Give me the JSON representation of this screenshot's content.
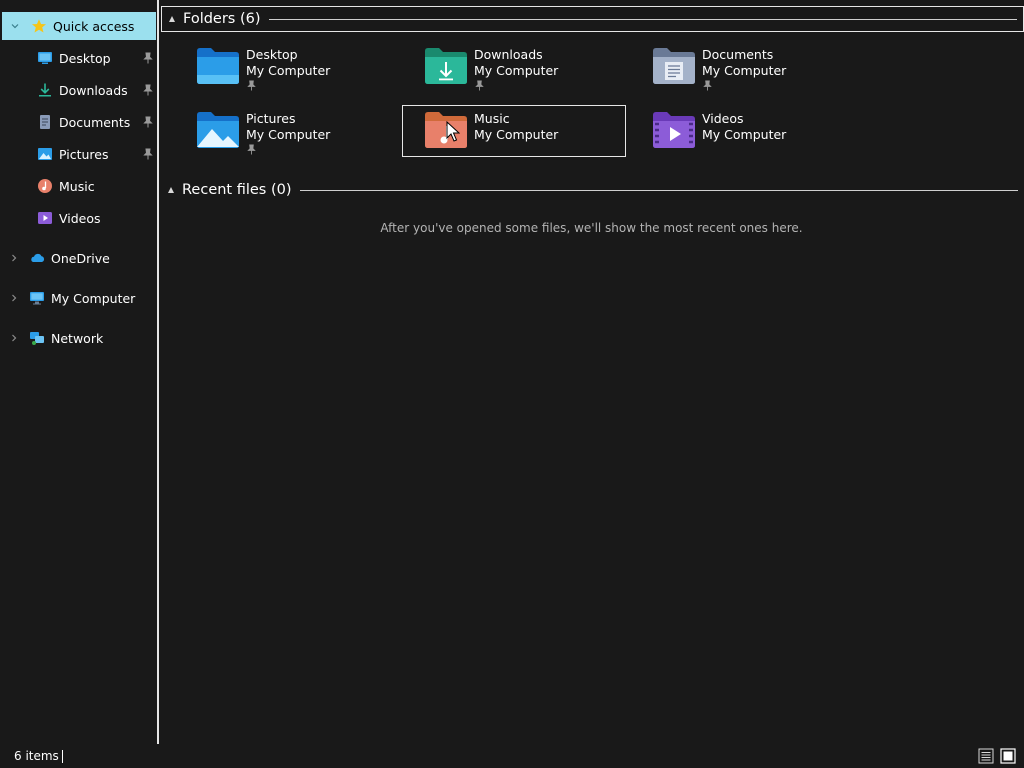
{
  "nav": {
    "quick_access": "Quick access",
    "pinned": [
      {
        "label": "Desktop",
        "icon": "desktop-icon",
        "pinned": true
      },
      {
        "label": "Downloads",
        "icon": "downloads-icon",
        "pinned": true
      },
      {
        "label": "Documents",
        "icon": "documents-icon",
        "pinned": true
      },
      {
        "label": "Pictures",
        "icon": "pictures-icon",
        "pinned": true
      },
      {
        "label": "Music",
        "icon": "music-icon",
        "pinned": false
      },
      {
        "label": "Videos",
        "icon": "videos-icon",
        "pinned": false
      }
    ],
    "roots": [
      {
        "label": "OneDrive",
        "icon": "onedrive-icon"
      },
      {
        "label": "My Computer",
        "icon": "computer-icon"
      },
      {
        "label": "Network",
        "icon": "network-icon"
      }
    ]
  },
  "folders_group": {
    "title": "Folders (6)",
    "items": [
      {
        "name": "Desktop",
        "location": "My Computer",
        "pinned": true
      },
      {
        "name": "Downloads",
        "location": "My Computer",
        "pinned": true
      },
      {
        "name": "Documents",
        "location": "My Computer",
        "pinned": true
      },
      {
        "name": "Pictures",
        "location": "My Computer",
        "pinned": true
      },
      {
        "name": "Music",
        "location": "My Computer",
        "pinned": false
      },
      {
        "name": "Videos",
        "location": "My Computer",
        "pinned": false
      }
    ]
  },
  "recent_group": {
    "title": "Recent files (0)",
    "empty_message": "After you've opened some files, we'll show the most recent ones here."
  },
  "status": {
    "item_count": "6 items"
  },
  "colors": {
    "selection": "#9be0ee",
    "background": "#191919",
    "desktop": "#2b9de8",
    "downloads": "#2bb89a",
    "documents": "#8a9bb8",
    "pictures": "#2b9de8",
    "music": "#e8806a",
    "videos": "#8c5cd8"
  }
}
